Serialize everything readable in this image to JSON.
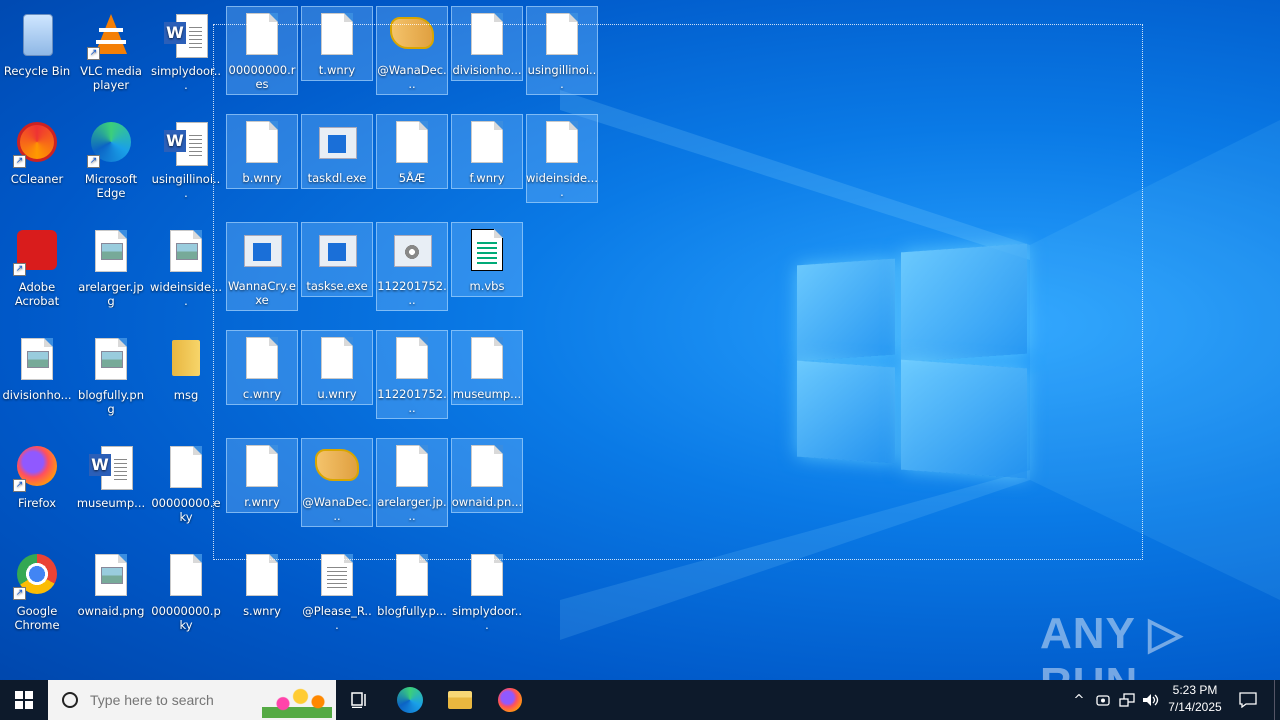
{
  "desktop": {
    "icons": [
      {
        "label": "Recycle Bin",
        "type": "recycle"
      },
      {
        "label": "VLC media player",
        "type": "vlc"
      },
      {
        "label": "simplydoor...",
        "type": "word"
      },
      {
        "label": "CCleaner",
        "type": "ccleaner"
      },
      {
        "label": "Microsoft Edge",
        "type": "edge"
      },
      {
        "label": "usingillinoi...",
        "type": "word"
      },
      {
        "label": "Adobe Acrobat",
        "type": "acrobat"
      },
      {
        "label": "arelarger.jpg",
        "type": "image"
      },
      {
        "label": "wideinside....",
        "type": "image"
      },
      {
        "label": "divisionho...",
        "type": "image"
      },
      {
        "label": "blogfully.png",
        "type": "image"
      },
      {
        "label": "msg",
        "type": "folder"
      },
      {
        "label": "Firefox",
        "type": "firefox"
      },
      {
        "label": "museump...",
        "type": "word"
      },
      {
        "label": "00000000.eky",
        "type": "blank"
      },
      {
        "label": "Google Chrome",
        "type": "chrome"
      },
      {
        "label": "ownaid.png",
        "type": "image"
      },
      {
        "label": "00000000.pky",
        "type": "blank"
      },
      {
        "label": "s.wnry",
        "type": "blank"
      },
      {
        "label": "@Please_R...",
        "type": "text"
      },
      {
        "label": "blogfully.p...",
        "type": "blank"
      },
      {
        "label": "simplydoor...",
        "type": "blank"
      }
    ],
    "selected_icons": [
      {
        "label": "00000000.res",
        "type": "blank"
      },
      {
        "label": "t.wnry",
        "type": "blank"
      },
      {
        "label": "@WanaDec...",
        "type": "wana"
      },
      {
        "label": "divisionho...",
        "type": "blank"
      },
      {
        "label": "usingillinoi...",
        "type": "blank"
      },
      {
        "label": "b.wnry",
        "type": "blank"
      },
      {
        "label": "taskdl.exe",
        "type": "exe"
      },
      {
        "label": "5ÅÆ",
        "type": "blank"
      },
      {
        "label": "f.wnry",
        "type": "blank"
      },
      {
        "label": "wideinside....",
        "type": "blank"
      },
      {
        "label": "WannaCry.exe",
        "type": "exe"
      },
      {
        "label": "taskse.exe",
        "type": "exe"
      },
      {
        "label": "112201752...",
        "type": "gear"
      },
      {
        "label": "m.vbs",
        "type": "vbs"
      },
      {
        "label": "c.wnry",
        "type": "blank"
      },
      {
        "label": "u.wnry",
        "type": "blank"
      },
      {
        "label": "112201752...",
        "type": "blank"
      },
      {
        "label": "museump...",
        "type": "blank"
      },
      {
        "label": "r.wnry",
        "type": "blank"
      },
      {
        "label": "@WanaDec...",
        "type": "wana"
      },
      {
        "label": "arelarger.jp...",
        "type": "blank"
      },
      {
        "label": "ownaid.pn...",
        "type": "blank"
      }
    ],
    "watermark": "ANY ▷ RUN"
  },
  "taskbar": {
    "start_icon": "windows-logo-icon",
    "search_placeholder": "Type here to search",
    "pinned": [
      "task-view-icon",
      "edge-icon",
      "file-explorer-icon",
      "firefox-icon"
    ],
    "tray": {
      "chevron": "^",
      "time": "5:23 PM",
      "date": "7/14/2025"
    }
  }
}
